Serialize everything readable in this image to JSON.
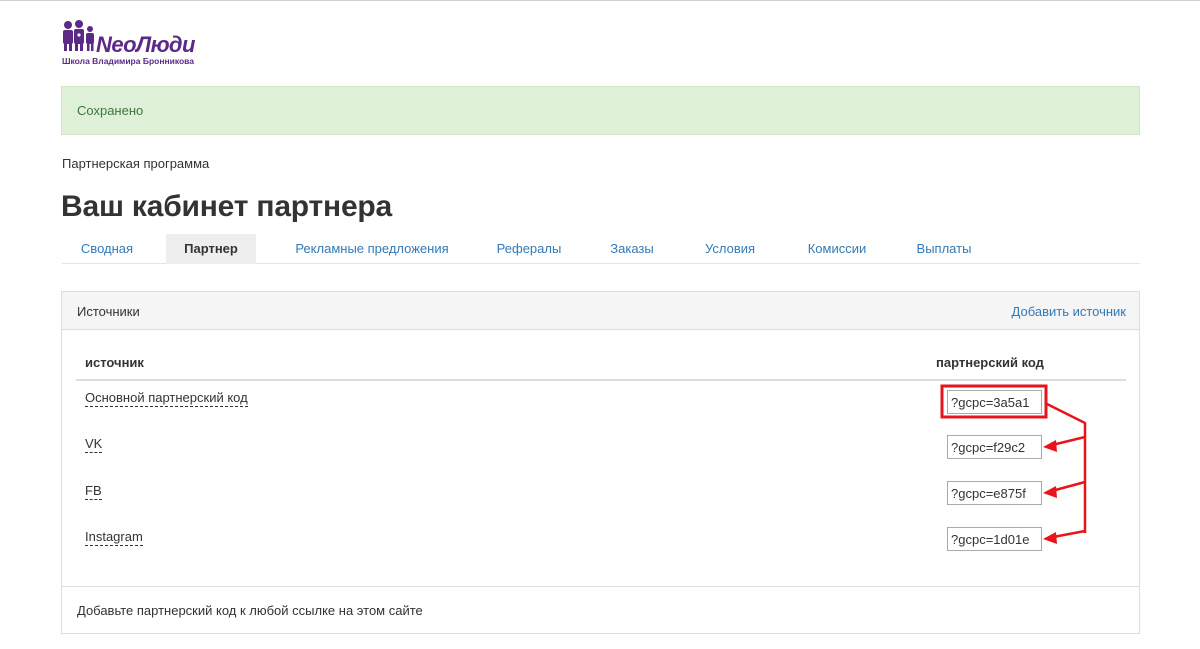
{
  "logo": {
    "name": "NeoЛюди",
    "subtitle": "Школа Владимира Бронникова",
    "color": "#5b2a86"
  },
  "alert": {
    "text": "Сохранено"
  },
  "breadcrumb": "Партнерская программа",
  "page_title": "Ваш кабинет партнера",
  "tabs": [
    {
      "label": "Сводная",
      "active": false
    },
    {
      "label": "Партнер",
      "active": true
    },
    {
      "label": "Рекламные предложения",
      "active": false
    },
    {
      "label": "Рефералы",
      "active": false
    },
    {
      "label": "Заказы",
      "active": false
    },
    {
      "label": "Условия",
      "active": false
    },
    {
      "label": "Комиссии",
      "active": false
    },
    {
      "label": "Выплаты",
      "active": false
    }
  ],
  "panel": {
    "title": "Источники",
    "add_link": "Добавить источник",
    "columns": {
      "source": "источник",
      "code": "партнерский код"
    },
    "rows": [
      {
        "source": "Основной партнерский код",
        "code": "?gcpc=3a5a1",
        "highlighted": true
      },
      {
        "source": "VK",
        "code": "?gcpc=f29c2",
        "highlighted": false
      },
      {
        "source": "FB",
        "code": "?gcpc=e875f",
        "highlighted": false
      },
      {
        "source": "Instagram",
        "code": "?gcpc=1d01e",
        "highlighted": false
      }
    ],
    "footer": "Добавьте партнерский код к любой ссылке на этом сайте"
  },
  "colors": {
    "link": "#337ab7",
    "alert_bg": "#dff0d8",
    "alert_text": "#3c763d",
    "annotation": "#e8141b"
  }
}
